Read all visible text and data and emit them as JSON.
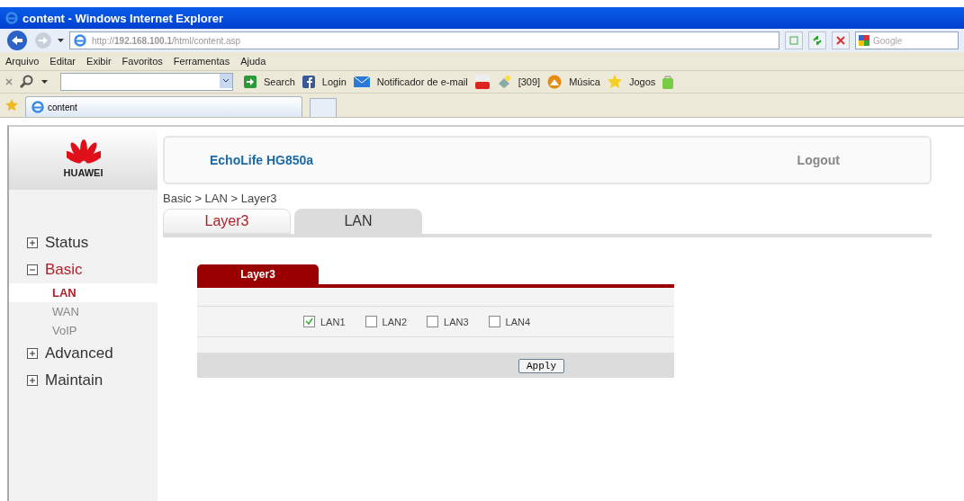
{
  "window": {
    "title": "content - Windows Internet Explorer"
  },
  "address_bar": {
    "url": "http://**192.168.100.1**/html/content.asp",
    "search_placeholder": "Google"
  },
  "menu_bar": [
    "Arquivo",
    "Editar",
    "Exibir",
    "Favoritos",
    "Ferramentas",
    "Ajuda"
  ],
  "toolbar": [
    {
      "kind": "search_button",
      "label": "Search"
    },
    {
      "kind": "facebook",
      "label": "Login"
    },
    {
      "kind": "mail",
      "label": "Notificador de e-mail"
    },
    {
      "kind": "youtube"
    },
    {
      "kind": "weather",
      "label": "[309]"
    },
    {
      "kind": "music",
      "label": "Música"
    },
    {
      "kind": "star",
      "label": "Jogos"
    },
    {
      "kind": "bag"
    }
  ],
  "browser_tabs": [
    {
      "label": "content",
      "selected": true
    }
  ],
  "page": {
    "logo": "HUAWEI",
    "product": "EchoLife HG850a",
    "logout": "Logout",
    "breadcrumb": "Basic > LAN > Layer3",
    "sidebar": [
      {
        "label": "Status",
        "expanded": false
      },
      {
        "label": "Basic",
        "expanded": true,
        "children": [
          {
            "label": "LAN",
            "selected": true
          },
          {
            "label": "WAN",
            "selected": false
          },
          {
            "label": "VoIP",
            "selected": false
          }
        ]
      },
      {
        "label": "Advanced",
        "expanded": false
      },
      {
        "label": "Maintain",
        "expanded": false
      }
    ],
    "tabs": [
      {
        "label": "Layer3",
        "selected": true
      },
      {
        "label": "LAN",
        "selected": false
      }
    ],
    "panel": {
      "title": "Layer3",
      "ports": [
        {
          "label": "LAN1",
          "checked": true
        },
        {
          "label": "LAN2",
          "checked": false
        },
        {
          "label": "LAN3",
          "checked": false
        },
        {
          "label": "LAN4",
          "checked": false
        }
      ],
      "apply": "Apply"
    }
  }
}
